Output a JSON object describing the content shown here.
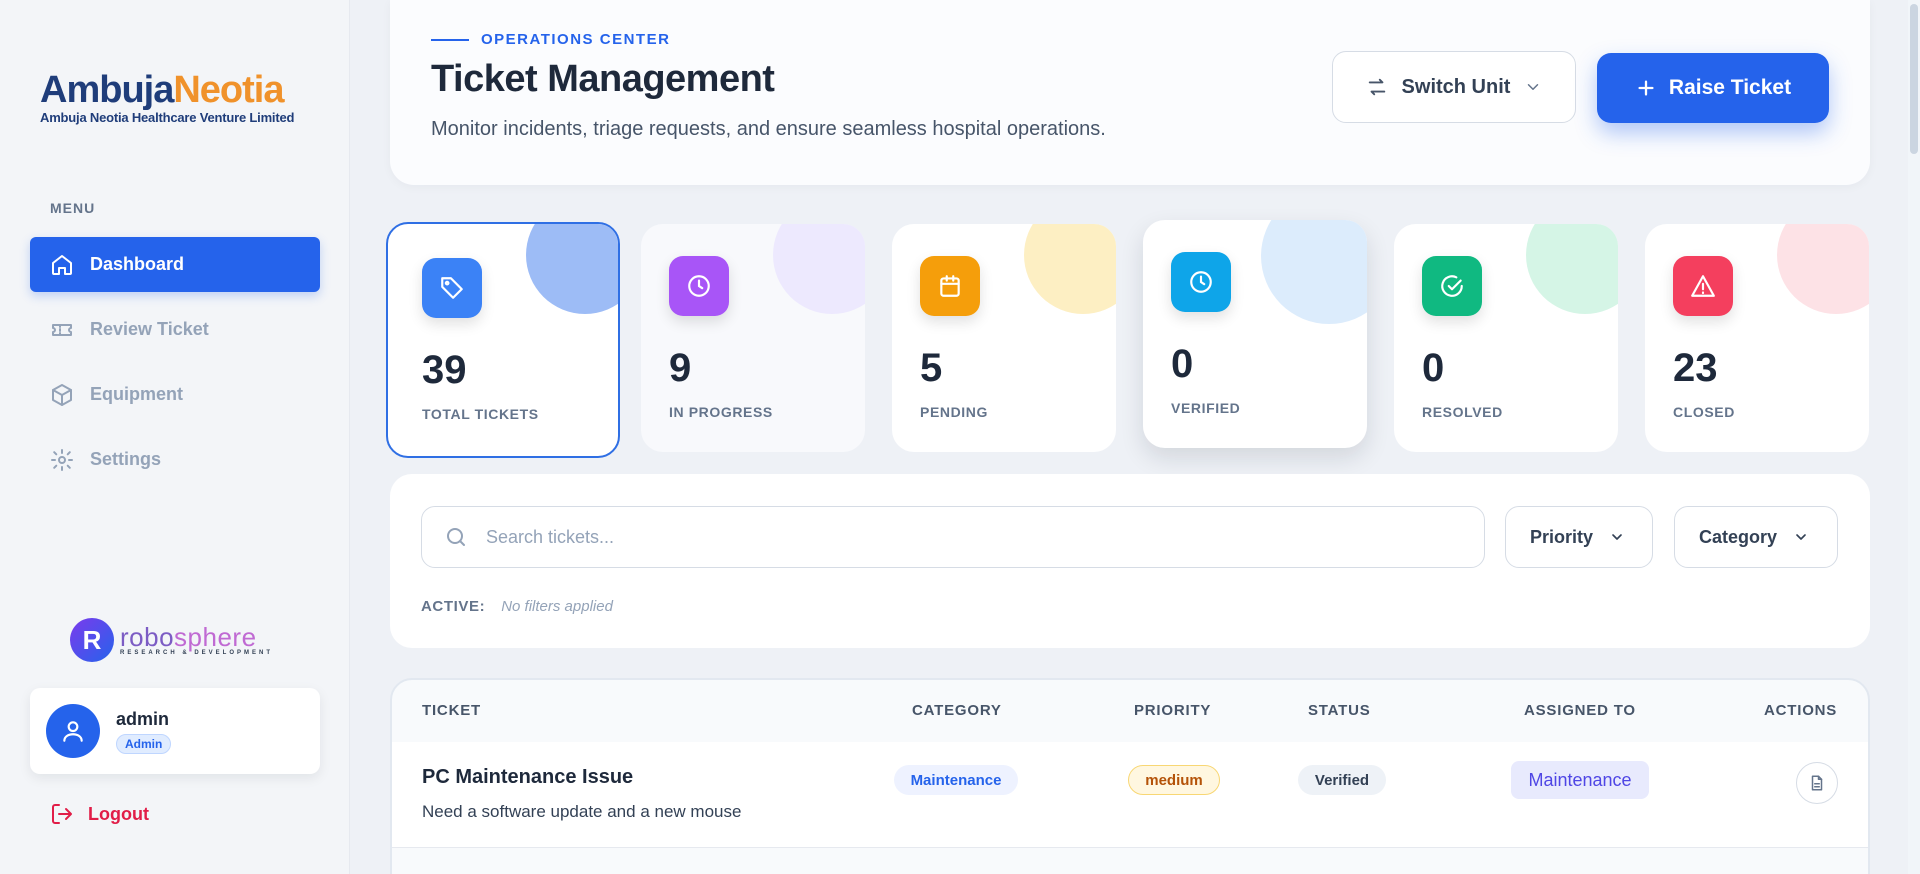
{
  "brand": {
    "logo_part1": "Ambuja",
    "logo_part2": "Neotia",
    "logo_sub": "Ambuja Neotia Healthcare Venture Limited"
  },
  "sidebar": {
    "menu_title": "MENU",
    "items": [
      {
        "label": "Dashboard",
        "icon": "home-icon",
        "active": true
      },
      {
        "label": "Review Ticket",
        "icon": "ticket-icon",
        "active": false
      },
      {
        "label": "Equipment",
        "icon": "box-icon",
        "active": false
      },
      {
        "label": "Settings",
        "icon": "gear-icon",
        "active": false
      }
    ],
    "partner": {
      "name_a": "robo",
      "name_b": "sphere",
      "tag": "RESEARCH & DEVELOPMENT"
    },
    "user": {
      "name": "admin",
      "role": "Admin"
    },
    "logout_label": "Logout"
  },
  "header": {
    "eyebrow": "OPERATIONS CENTER",
    "title": "Ticket Management",
    "subtitle": "Monitor incidents, triage requests, and ensure seamless hospital operations.",
    "switch_label": "Switch Unit",
    "raise_label": "Raise Ticket"
  },
  "stats": [
    {
      "value": "39",
      "label": "TOTAL TICKETS",
      "icon": "tag-icon",
      "color": "#3b82f6"
    },
    {
      "value": "9",
      "label": "IN PROGRESS",
      "icon": "clock-icon",
      "color": "#a855f7"
    },
    {
      "value": "5",
      "label": "PENDING",
      "icon": "calendar-icon",
      "color": "#f59e0b"
    },
    {
      "value": "0",
      "label": "VERIFIED",
      "icon": "clock-icon",
      "color": "#0ea5e9"
    },
    {
      "value": "0",
      "label": "RESOLVED",
      "icon": "check-circle-icon",
      "color": "#10b981"
    },
    {
      "value": "23",
      "label": "CLOSED",
      "icon": "alert-triangle-icon",
      "color": "#f43f5e"
    }
  ],
  "filters": {
    "search_placeholder": "Search tickets...",
    "priority_label": "Priority",
    "category_label": "Category",
    "active_key": "ACTIVE:",
    "active_value": "No filters applied"
  },
  "table": {
    "columns": [
      "TICKET",
      "CATEGORY",
      "PRIORITY",
      "STATUS",
      "ASSIGNED TO",
      "ACTIONS"
    ],
    "rows": [
      {
        "title": "PC Maintenance Issue",
        "description": "Need a software update and a new mouse",
        "category": "Maintenance",
        "priority": "medium",
        "status": "Verified",
        "assigned_to": "Maintenance"
      }
    ]
  }
}
